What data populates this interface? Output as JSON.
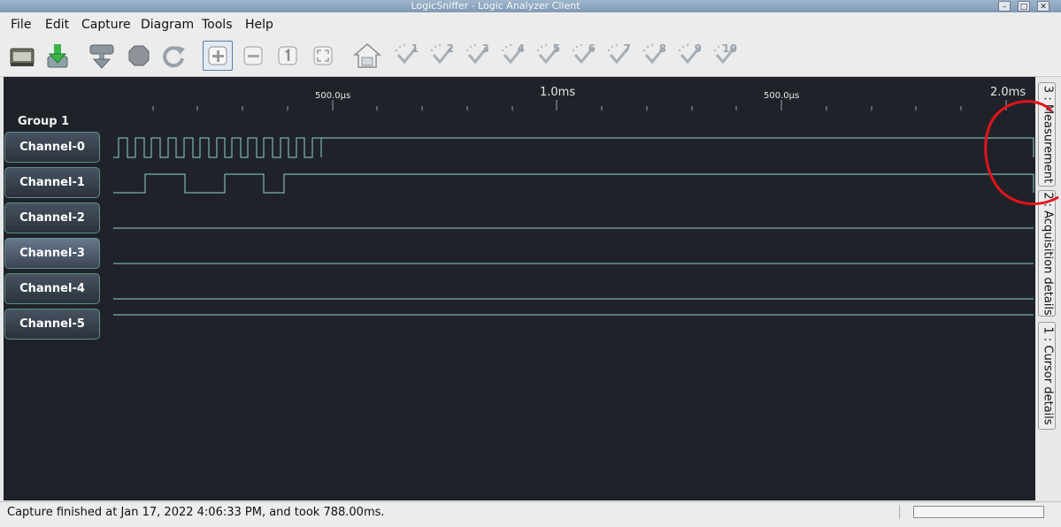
{
  "window": {
    "title": "LogicSniffer - Logic Analyzer Client",
    "min": "–",
    "max": "□",
    "close": "✕"
  },
  "menu": [
    "File",
    "Edit",
    "Capture",
    "Diagram",
    "Tools",
    "Help"
  ],
  "toolbar": {
    "open": "folder-open-icon",
    "save": "save-download-icon",
    "capture": "capture-icon",
    "stop": "stop-icon",
    "repeat": "repeat-capture-icon",
    "zoom_in": "zoom-in-icon",
    "zoom_out": "zoom-out-icon",
    "zoom_original": "zoom-original-icon",
    "zoom_fit": "zoom-fit-icon",
    "home": "home-icon",
    "markers": [
      "1",
      "2",
      "3",
      "4",
      "5",
      "6",
      "7",
      "8",
      "9",
      "10"
    ]
  },
  "timeline": {
    "labels": [
      "500.0µs",
      "1.0ms",
      "500.0µs",
      "2.0ms"
    ]
  },
  "group": {
    "name": "Group 1"
  },
  "channels": [
    "Channel-0",
    "Channel-1",
    "Channel-2",
    "Channel-3",
    "Channel-4",
    "Channel-5"
  ],
  "side_tabs": [
    "3 : Measurement",
    "2 : Acquisition details",
    "1 : Cursor details"
  ],
  "status": {
    "text": "Capture finished at Jan 17, 2022 4:06:33 PM, and took 788.00ms."
  },
  "colors": {
    "signal": "#8fd3cf",
    "diagram_bg": "#1f2329",
    "annotation": "#e4131b"
  }
}
